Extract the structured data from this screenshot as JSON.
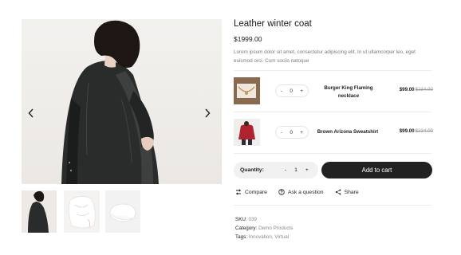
{
  "product": {
    "title": "Leather winter coat",
    "price": "$1999.00",
    "description": "Lorem ipsum dolor sit amet, consectetur adipiscing elit. In ut ullamcorper leo, eget euismod orci. Cum sociis natoque"
  },
  "gallery": {
    "prev_icon": "chevron-left-icon",
    "next_icon": "chevron-right-icon",
    "thumbnails": [
      "leather-coat",
      "white-hoodie",
      "white-cap"
    ]
  },
  "bundle": {
    "items": [
      {
        "name": "Burger King Flaming necklace",
        "qty": "0",
        "minus": "-",
        "plus": "+",
        "price": "$99.00",
        "old_price": "$234.00"
      },
      {
        "name": "Brown Arizona Sweatshirt",
        "qty": "0",
        "minus": "-",
        "plus": "+",
        "price": "$99.00",
        "old_price": "$234.00"
      }
    ]
  },
  "purchase": {
    "qty_label": "Quantity:",
    "minus": "-",
    "qty": "1",
    "plus": "+",
    "add_to_cart": "Add to cart"
  },
  "actions": {
    "compare": "Compare",
    "ask": "Ask a question",
    "share": "Share"
  },
  "meta": {
    "sku_label": "SKU:",
    "sku": "039",
    "category_label": "Category:",
    "category": "Demo Products",
    "tags_label": "Tags:",
    "tags": "Innovation, Virtual"
  },
  "colors": {
    "accent": "#222222",
    "muted_text": "#7a7a7a",
    "pill_bg": "#f1f1f1"
  }
}
